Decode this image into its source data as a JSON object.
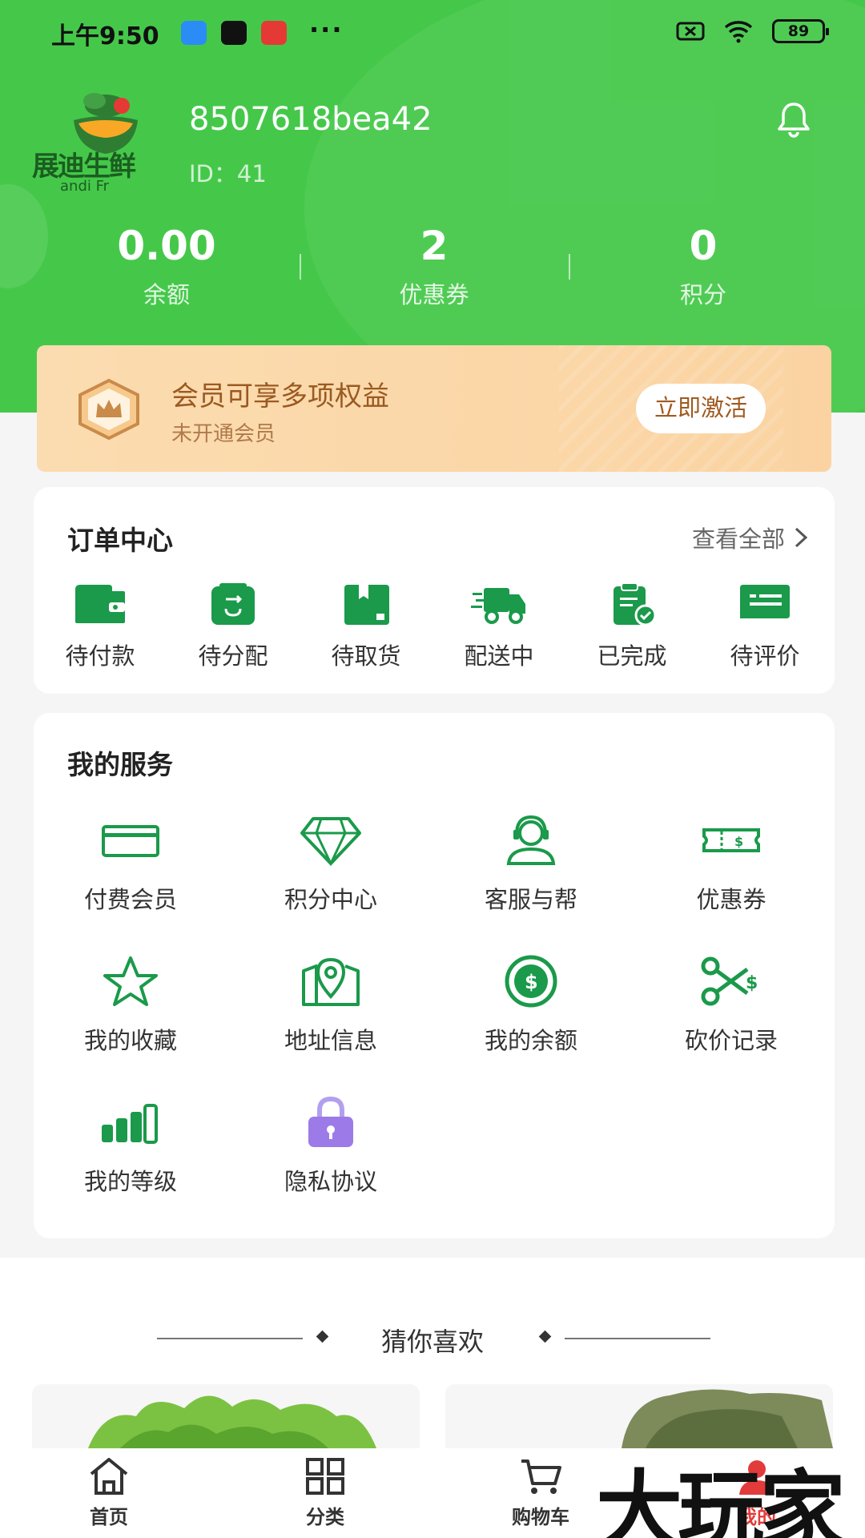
{
  "status_bar": {
    "time": "上午9:50",
    "dots": "···",
    "battery": "89"
  },
  "profile": {
    "logo_text": "展迪生鲜",
    "logo_sub": "andi Fr",
    "username": "8507618bea42",
    "user_id": "ID：41"
  },
  "stats": [
    {
      "value": "0.00",
      "label": "余额"
    },
    {
      "value": "2",
      "label": "优惠券"
    },
    {
      "value": "0",
      "label": "积分"
    }
  ],
  "member": {
    "title": "会员可享多项权益",
    "subtitle": "未开通会员",
    "button": "立即激活"
  },
  "orders": {
    "title": "订单中心",
    "view_all": "查看全部",
    "items": [
      {
        "label": "待付款",
        "icon": "wallet-icon"
      },
      {
        "label": "待分配",
        "icon": "allocate-icon"
      },
      {
        "label": "待取货",
        "icon": "package-icon"
      },
      {
        "label": "配送中",
        "icon": "truck-icon"
      },
      {
        "label": "已完成",
        "icon": "clipboard-check-icon"
      },
      {
        "label": "待评价",
        "icon": "comment-icon"
      }
    ]
  },
  "services": {
    "title": "我的服务",
    "items": [
      {
        "label": "付费会员",
        "icon": "card-icon"
      },
      {
        "label": "积分中心",
        "icon": "diamond-icon"
      },
      {
        "label": "客服与帮",
        "icon": "headset-icon"
      },
      {
        "label": "优惠券",
        "icon": "ticket-icon"
      },
      {
        "label": "我的收藏",
        "icon": "star-icon"
      },
      {
        "label": "地址信息",
        "icon": "map-pin-icon"
      },
      {
        "label": "我的余额",
        "icon": "coin-icon"
      },
      {
        "label": "砍价记录",
        "icon": "scissors-icon"
      },
      {
        "label": "我的等级",
        "icon": "level-bars-icon"
      },
      {
        "label": "隐私协议",
        "icon": "lock-icon"
      }
    ]
  },
  "guess": {
    "title": "猜你喜欢"
  },
  "tabbar": [
    {
      "label": "首页",
      "icon": "home-icon"
    },
    {
      "label": "分类",
      "icon": "grid-icon"
    },
    {
      "label": "购物车",
      "icon": "cart-icon"
    },
    {
      "label": "我的",
      "icon": "user-icon"
    }
  ],
  "watermark": "大玩家",
  "colors": {
    "primary_green": "#45c84a",
    "icon_green": "#1a9a4a",
    "member_brown": "#9a5a22",
    "active_red": "#e23b3b",
    "lock_purple": "#9c7be8"
  }
}
